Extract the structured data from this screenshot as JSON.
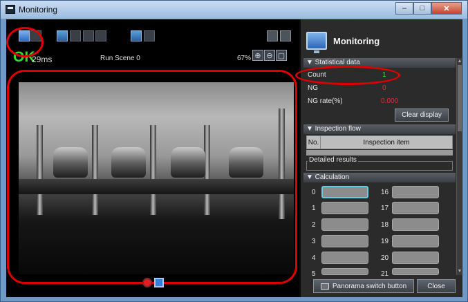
{
  "window": {
    "title": "Monitoring",
    "min_glyph": "–",
    "max_glyph": "□",
    "close_glyph": "✕"
  },
  "camera": {
    "judgement": "OK",
    "judgement_color": "#2ee02e",
    "time": "29ms",
    "scene": "Run Scene 0",
    "zoom": "67%"
  },
  "panel": {
    "title": "Monitoring",
    "statistical": {
      "header": "▼ Statistical data",
      "count_label": "Count",
      "count_value": "1",
      "ng_label": "NG",
      "ng_value": "0",
      "ng_rate_label": "NG rate(%)",
      "ng_rate_value": "0.000",
      "clear_button": "Clear display"
    },
    "inspection": {
      "header": "▼ Inspection flow",
      "col_no": "No.",
      "col_item": "Inspection item",
      "detailed": "Detailed results"
    },
    "calculation": {
      "header": "▼ Calculation",
      "left": [
        "0",
        "1",
        "2",
        "3",
        "4",
        "5"
      ],
      "right": [
        "16",
        "17",
        "18",
        "19",
        "20",
        "21"
      ]
    },
    "panorama_button": "Panorama switch button",
    "close_button": "Close"
  }
}
